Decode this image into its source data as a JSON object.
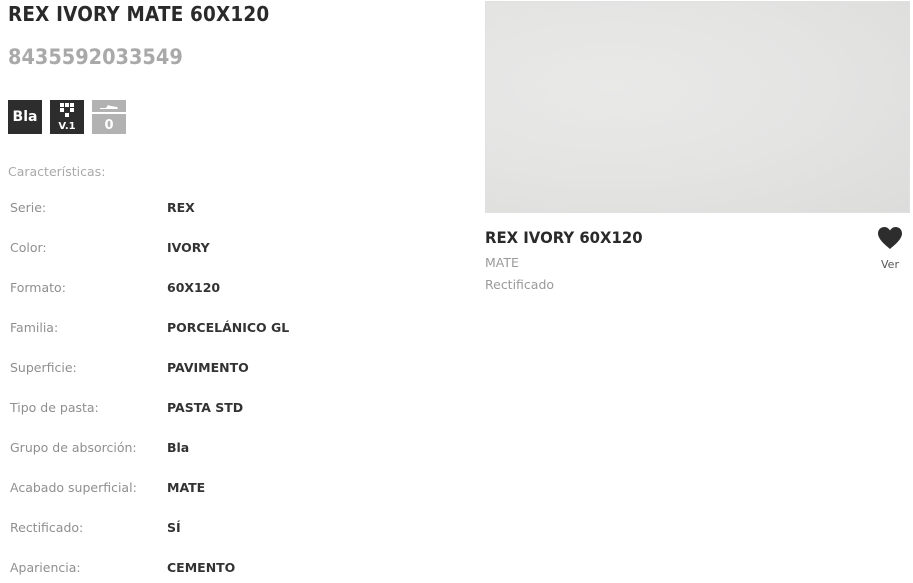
{
  "product": {
    "title": "REX IVORY MATE 60X120",
    "ean": "8435592033549"
  },
  "badges": {
    "absorption": "Bla",
    "variation": "V.1",
    "slip": "0"
  },
  "characteristics": {
    "heading": "Características:",
    "rows": [
      {
        "label": "Serie:",
        "value": "REX"
      },
      {
        "label": "Color:",
        "value": "IVORY"
      },
      {
        "label": "Formato:",
        "value": "60X120"
      },
      {
        "label": "Familia:",
        "value": "PORCELÁNICO GL"
      },
      {
        "label": "Superficie:",
        "value": "PAVIMENTO"
      },
      {
        "label": "Tipo de pasta:",
        "value": "PASTA STD"
      },
      {
        "label": "Grupo de absorción:",
        "value": "Bla"
      },
      {
        "label": "Acabado superficial:",
        "value": "MATE"
      },
      {
        "label": "Rectificado:",
        "value": "SÍ"
      },
      {
        "label": "Apariencia:",
        "value": "CEMENTO"
      }
    ]
  },
  "card": {
    "title": "REX IVORY 60X120",
    "finish": "MATE",
    "rectified": "Rectificado",
    "fav_label": "Ver"
  },
  "colors": {
    "badge_dark": "#2d2d2d",
    "badge_grey": "#b2b2b2",
    "tile_surface": "#e4e4e3",
    "muted_text": "#a9a9a9"
  },
  "icons": {
    "variation": "grid-dots-icon",
    "slip": "shoe-icon",
    "favorite": "heart-icon"
  }
}
